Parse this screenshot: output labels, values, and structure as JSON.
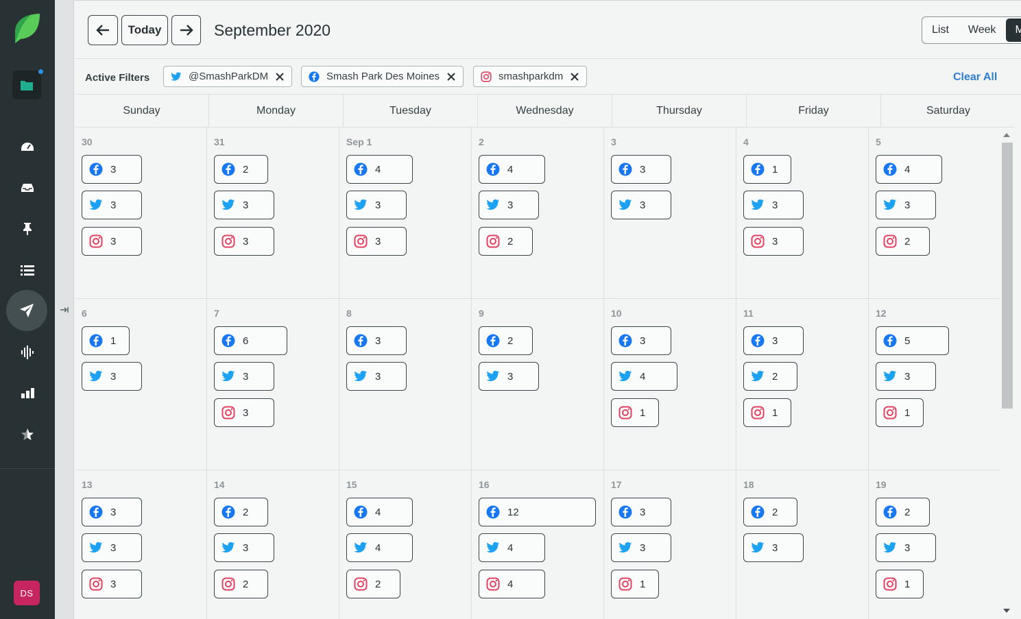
{
  "sidebar": {
    "avatar_initials": "DS",
    "items": [
      "folder-icon",
      "dashboard-icon",
      "inbox-icon",
      "pin-icon",
      "list-icon",
      "send-icon",
      "audio-wave-icon",
      "bar-chart-icon",
      "star-icon"
    ]
  },
  "header": {
    "today_label": "Today",
    "month_title": "September 2020",
    "views": [
      "List",
      "Week",
      "Month"
    ]
  },
  "filters": {
    "label": "Active Filters",
    "chips": [
      {
        "network": "twitter",
        "label": "@SmashParkDM"
      },
      {
        "network": "facebook",
        "label": "Smash Park Des Moines"
      },
      {
        "network": "instagram",
        "label": "smashparkdm"
      }
    ],
    "clear_label": "Clear All"
  },
  "weekdays": [
    "Sunday",
    "Monday",
    "Tuesday",
    "Wednesday",
    "Thursday",
    "Friday",
    "Saturday"
  ],
  "weeks": [
    [
      {
        "date": "30",
        "posts": [
          [
            "facebook",
            "3"
          ],
          [
            "twitter",
            "3"
          ],
          [
            "instagram",
            "3"
          ]
        ]
      },
      {
        "date": "31",
        "posts": [
          [
            "facebook",
            "2"
          ],
          [
            "twitter",
            "3"
          ],
          [
            "instagram",
            "3"
          ]
        ]
      },
      {
        "date": "Sep 1",
        "posts": [
          [
            "facebook",
            "4"
          ],
          [
            "twitter",
            "3"
          ],
          [
            "instagram",
            "3"
          ]
        ]
      },
      {
        "date": "2",
        "posts": [
          [
            "facebook",
            "4"
          ],
          [
            "twitter",
            "3"
          ],
          [
            "instagram",
            "2"
          ]
        ]
      },
      {
        "date": "3",
        "posts": [
          [
            "facebook",
            "3"
          ],
          [
            "twitter",
            "3"
          ]
        ]
      },
      {
        "date": "4",
        "posts": [
          [
            "facebook",
            "1"
          ],
          [
            "twitter",
            "3"
          ],
          [
            "instagram",
            "3"
          ]
        ]
      },
      {
        "date": "5",
        "posts": [
          [
            "facebook",
            "4"
          ],
          [
            "twitter",
            "3"
          ],
          [
            "instagram",
            "2"
          ]
        ]
      }
    ],
    [
      {
        "date": "6",
        "posts": [
          [
            "facebook",
            "1"
          ],
          [
            "twitter",
            "3"
          ]
        ]
      },
      {
        "date": "7",
        "posts": [
          [
            "facebook",
            "6"
          ],
          [
            "twitter",
            "3"
          ],
          [
            "instagram",
            "3"
          ]
        ]
      },
      {
        "date": "8",
        "posts": [
          [
            "facebook",
            "3"
          ],
          [
            "twitter",
            "3"
          ]
        ]
      },
      {
        "date": "9",
        "posts": [
          [
            "facebook",
            "2"
          ],
          [
            "twitter",
            "3"
          ]
        ]
      },
      {
        "date": "10",
        "posts": [
          [
            "facebook",
            "3"
          ],
          [
            "twitter",
            "4"
          ],
          [
            "instagram",
            "1"
          ]
        ]
      },
      {
        "date": "11",
        "posts": [
          [
            "facebook",
            "3"
          ],
          [
            "twitter",
            "2"
          ],
          [
            "instagram",
            "1"
          ]
        ]
      },
      {
        "date": "12",
        "posts": [
          [
            "facebook",
            "5"
          ],
          [
            "twitter",
            "3"
          ],
          [
            "instagram",
            "1"
          ]
        ]
      }
    ],
    [
      {
        "date": "13",
        "posts": [
          [
            "facebook",
            "3"
          ],
          [
            "twitter",
            "3"
          ],
          [
            "instagram",
            "3"
          ]
        ]
      },
      {
        "date": "14",
        "posts": [
          [
            "facebook",
            "2"
          ],
          [
            "twitter",
            "3"
          ],
          [
            "instagram",
            "2"
          ]
        ]
      },
      {
        "date": "15",
        "posts": [
          [
            "facebook",
            "4"
          ],
          [
            "twitter",
            "4"
          ],
          [
            "instagram",
            "2"
          ]
        ]
      },
      {
        "date": "16",
        "posts": [
          [
            "facebook",
            "12"
          ],
          [
            "twitter",
            "4"
          ],
          [
            "instagram",
            "4"
          ]
        ]
      },
      {
        "date": "17",
        "posts": [
          [
            "facebook",
            "3"
          ],
          [
            "twitter",
            "3"
          ],
          [
            "instagram",
            "1"
          ]
        ]
      },
      {
        "date": "18",
        "posts": [
          [
            "facebook",
            "2"
          ],
          [
            "twitter",
            "3"
          ]
        ]
      },
      {
        "date": "19",
        "posts": [
          [
            "facebook",
            "2"
          ],
          [
            "twitter",
            "3"
          ],
          [
            "instagram",
            "1"
          ]
        ]
      }
    ]
  ],
  "colors": {
    "facebook": "#1877f2",
    "twitter": "#1da1f2",
    "instagram": "#e4405f",
    "sidebar": "#283133",
    "link": "#2e7fd1"
  }
}
